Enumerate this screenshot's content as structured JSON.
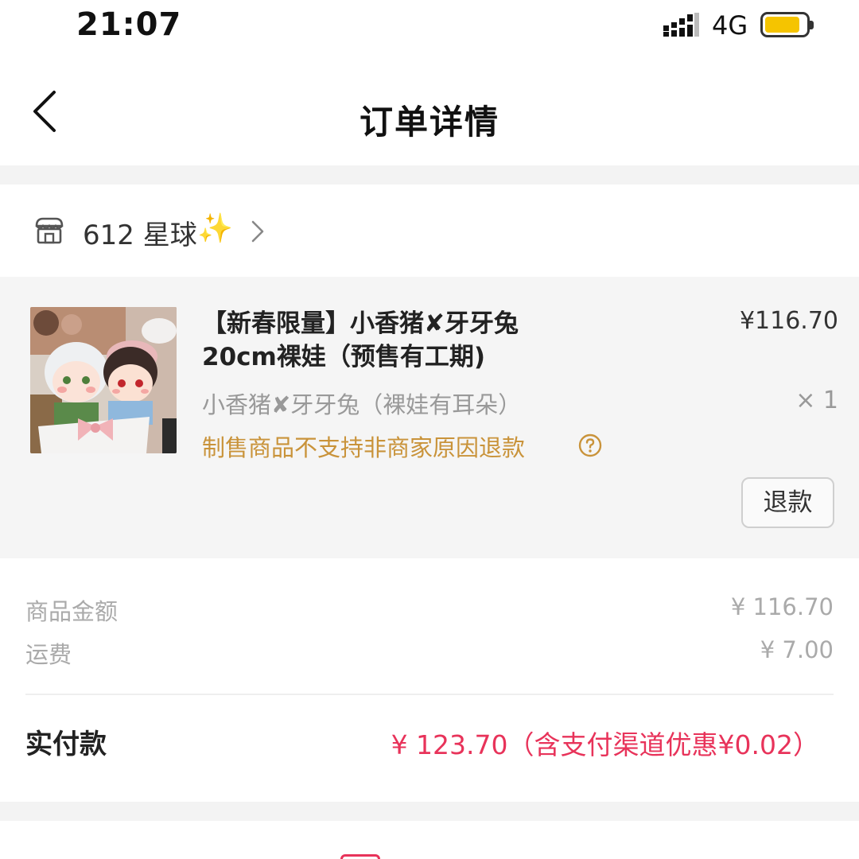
{
  "status_bar": {
    "time": "21:07",
    "network": "4G",
    "battery_color": "#f5c400"
  },
  "nav": {
    "title": "订单详情",
    "back_icon": "chevron-left-icon"
  },
  "shop": {
    "icon": "store-icon",
    "name": "612 星球",
    "sparkle": "✨",
    "chevron_icon": "chevron-right-icon"
  },
  "item": {
    "title": "【新春限量】小香猪✘牙牙兔20cm裸娃（预售有工期)",
    "price": "¥116.70",
    "variant": "小香猪✘牙牙兔（裸娃有耳朵）",
    "quantity": "× 1",
    "notice": "制售商品不支持非商家原因退款",
    "help_icon": "question-circle-icon",
    "refund_label": "退款"
  },
  "amounts": {
    "goods_label": "商品金额",
    "goods_value": "¥ 116.70",
    "shipping_label": "运费",
    "shipping_value": "¥ 7.00",
    "paid_label": "实付款",
    "paid_value": "¥ 123.70（含支付渠道优惠¥0.02）",
    "paid_color": "#e8335a"
  }
}
